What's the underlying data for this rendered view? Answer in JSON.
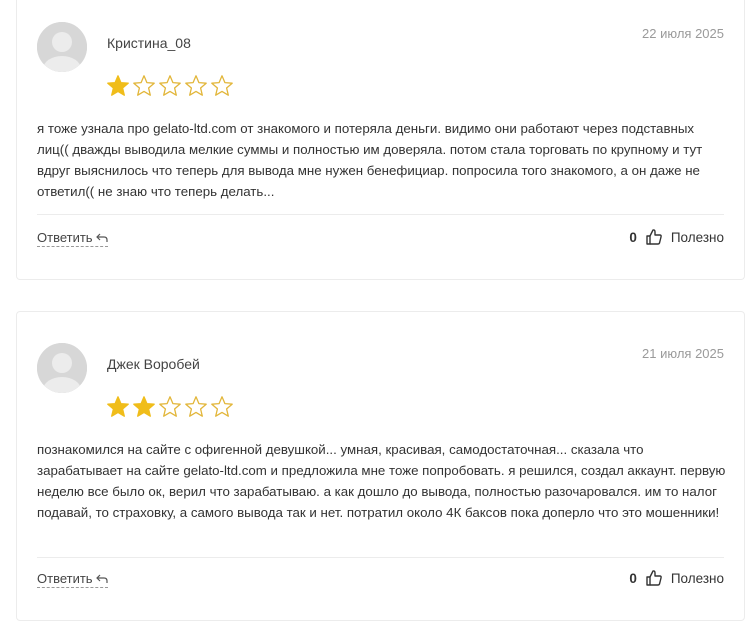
{
  "reviews": [
    {
      "author": "Кристина_08",
      "date": "22 июля 2025",
      "rating": 1,
      "max_rating": 5,
      "text": "я тоже узнала про gelato-ltd.com от знакомого и потеряла деньги. видимо они работают через подставных лиц(( дважды выводила мелкие суммы и полностью им доверяла. потом стала торговать по крупному и тут вдруг выяснилось что теперь для вывода мне нужен бенефициар. попросила того знакомого, а он даже не ответил(( не знаю что теперь делать...",
      "reply_label": "Ответить",
      "helpful_count": "0",
      "helpful_label": "Полезно"
    },
    {
      "author": "Джек Воробей",
      "date": "21 июля 2025",
      "rating": 2,
      "max_rating": 5,
      "text": "познакомился на сайте с офигенной девушкой... умная, красивая, самодостаточная... сказала что зарабатывает на сайте gelato-ltd.com и предложила мне тоже попробовать. я решился, создал аккаунт. первую неделю все было ок, верил что зарабатываю. а как дошло до вывода, полностью разочаровался. им то налог подавай, то страховку, а самого вывода так и нет. потратил около 4К баксов пока доперло что это мошенники!",
      "reply_label": "Ответить",
      "helpful_count": "0",
      "helpful_label": "Полезно"
    }
  ],
  "colors": {
    "star_filled": "#f0bd1a",
    "star_outline": "#e2b63a",
    "avatar_bg": "#d7d7d7",
    "border": "#ececec",
    "muted": "#9a9a9a"
  },
  "icons": {
    "avatar": "user-silhouette-icon",
    "star": "star-icon",
    "reply": "reply-arrow-icon",
    "helpful": "thumbs-up-icon"
  }
}
